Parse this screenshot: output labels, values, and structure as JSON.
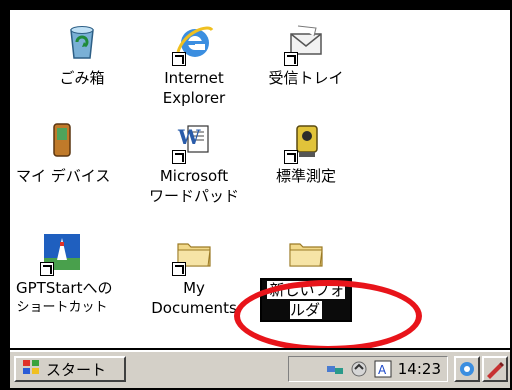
{
  "desktop": {
    "icons": [
      {
        "label_lines": [
          "ごみ箱"
        ]
      },
      {
        "label_lines": [
          "Internet",
          "Explorer"
        ]
      },
      {
        "label_lines": [
          "受信トレイ"
        ]
      },
      {
        "label_lines": [
          "マイ デバイス"
        ]
      },
      {
        "label_lines": [
          "Microsoft",
          "ワードパッド"
        ]
      },
      {
        "label_lines": [
          "標準測定"
        ]
      },
      {
        "label_lines": [
          "GPTStartへの",
          "ショートカット"
        ]
      },
      {
        "label_lines": [
          "My",
          "Documents"
        ]
      },
      {
        "label_value": "新しいフォルダ"
      }
    ]
  },
  "taskbar": {
    "start_label": "スタート",
    "clock": "14:23"
  },
  "colors": {
    "highlight_ring": "#e8141a",
    "taskbar_bg": "#d4d0c8",
    "desktop_bg": "#ffffff"
  }
}
